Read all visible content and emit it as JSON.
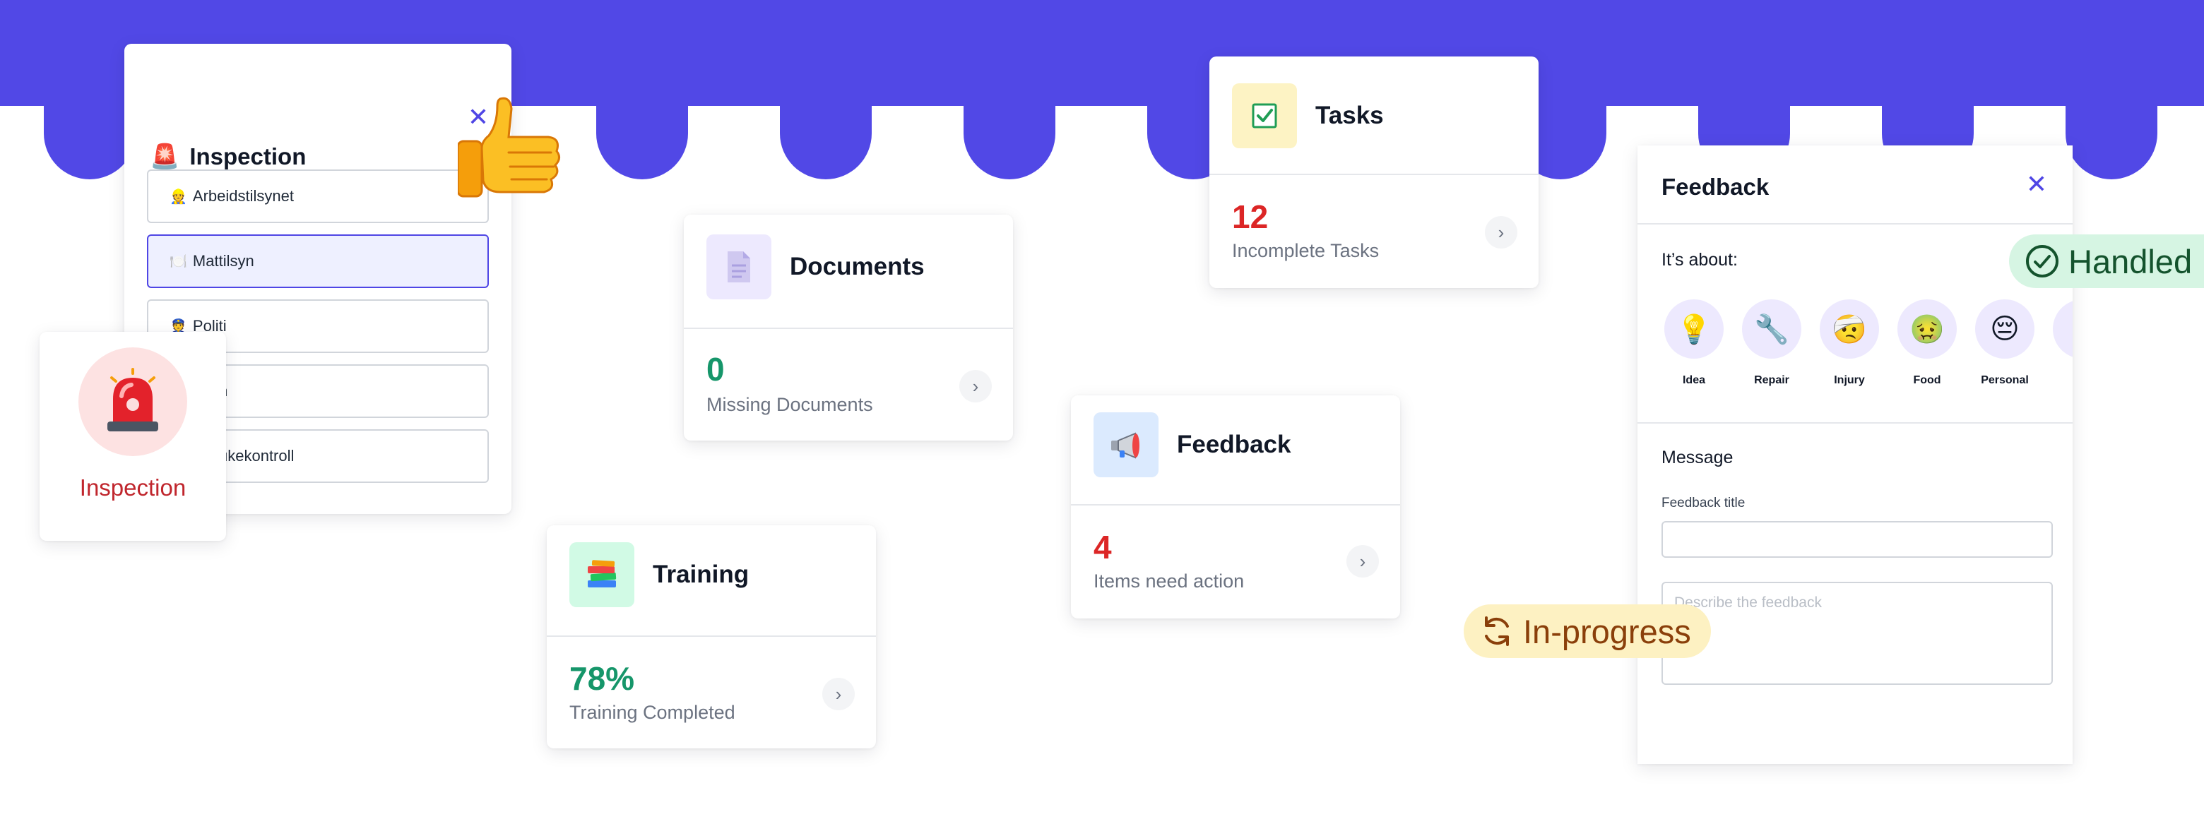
{
  "colors": {
    "banner": "#5148e6",
    "accent": "#4f46e5",
    "green": "#16966a",
    "red": "#dc2626"
  },
  "inspection_dropdown": {
    "title": "Inspection",
    "title_icon": "siren-icon",
    "close_icon": "close-icon",
    "options": [
      {
        "icon": "👷",
        "label": "Arbeidstilsynet",
        "selected": false
      },
      {
        "icon": "🍽️",
        "label": "Mattilsyn",
        "selected": true
      },
      {
        "icon": "👮",
        "label": "Politi",
        "selected": false
      },
      {
        "icon": "",
        "label": "n",
        "selected": false
      },
      {
        "icon": "",
        "label": "ukekontroll",
        "selected": false
      }
    ]
  },
  "inspection_card": {
    "icon": "siren-icon",
    "label": "Inspection"
  },
  "thumbs_icon": "thumbs-up-icon",
  "documents_card": {
    "icon": "document-icon",
    "title": "Documents",
    "value": "0",
    "subtitle": "Missing Documents"
  },
  "tasks_card": {
    "icon": "checkbox-icon",
    "title": "Tasks",
    "value": "12",
    "subtitle": "Incomplete Tasks"
  },
  "feedback_card": {
    "icon": "megaphone-icon",
    "title": "Feedback",
    "value": "4",
    "subtitle": "Items need action"
  },
  "training_card": {
    "icon": "books-icon",
    "title": "Training",
    "value": "78%",
    "subtitle": "Training Completed"
  },
  "feedback_panel": {
    "title": "Feedback",
    "about_label": "It’s about:",
    "categories": [
      {
        "emoji": "💡",
        "label": "Idea"
      },
      {
        "emoji": "🔧",
        "label": "Repair"
      },
      {
        "emoji": "🤕",
        "label": "Injury"
      },
      {
        "emoji": "🤢",
        "label": "Food"
      },
      {
        "emoji": "😔",
        "label": "Personal"
      }
    ],
    "message_heading": "Message",
    "field_label": "Feedback title",
    "field_value": "",
    "textarea_placeholder": "Describe the feedback"
  },
  "status_pills": {
    "handled": "Handled",
    "in_progress": "In-progress"
  }
}
